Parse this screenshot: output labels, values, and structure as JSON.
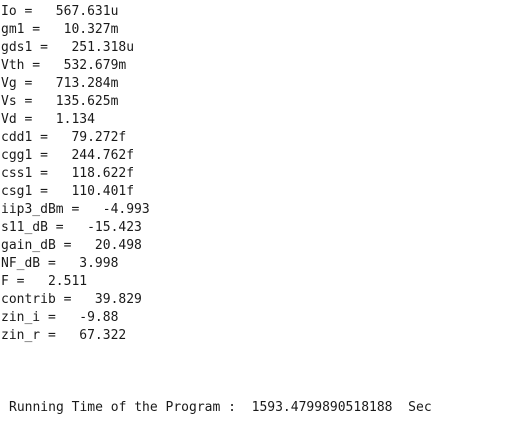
{
  "output": {
    "lines": [
      "Io =   567.631u",
      "gm1 =   10.327m",
      "gds1 =   251.318u",
      "Vth =   532.679m",
      "Vg =   713.284m",
      "Vs =   135.625m",
      "Vd =   1.134",
      "cdd1 =   79.272f",
      "cgg1 =   244.762f",
      "css1 =   118.622f",
      "csg1 =   110.401f",
      "iip3_dBm =   -4.993",
      "s11_dB =   -15.423",
      "gain_dB =   20.498",
      "NF_dB =   3.998",
      "F =   2.511",
      "contrib =   39.829",
      "zin_i =   -9.88",
      "zin_r =   67.322"
    ],
    "footer": "Running Time of the Program :  1593.4799890518188  Sec"
  }
}
